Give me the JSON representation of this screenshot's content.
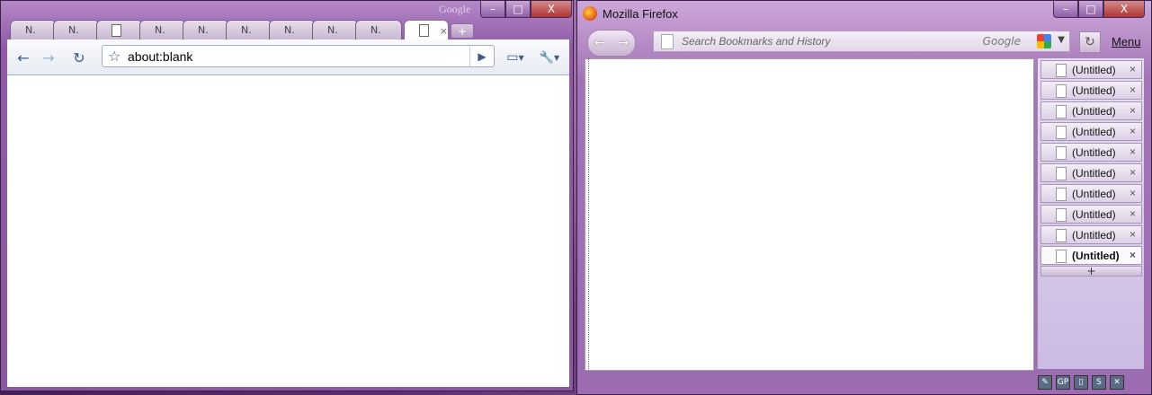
{
  "chrome": {
    "brand": "Google",
    "controls": {
      "minimize": "–",
      "maximize": "□",
      "close": "X"
    },
    "tabs": [
      {
        "label": "N."
      },
      {
        "label": "N."
      },
      {
        "label": ""
      },
      {
        "label": "N."
      },
      {
        "label": "N."
      },
      {
        "label": "N."
      },
      {
        "label": "N."
      },
      {
        "label": "N."
      },
      {
        "label": "N."
      },
      {
        "label": "",
        "active": true
      }
    ],
    "new_tab_label": "+",
    "toolbar": {
      "back_icon": "←",
      "forward_icon": "→",
      "reload_icon": "↻",
      "star_icon": "☆",
      "go_icon": "▶",
      "page_icon": "▭",
      "wrench_icon": "🔧",
      "url": "about:blank"
    }
  },
  "firefox": {
    "title": "Mozilla Firefox",
    "controls": {
      "minimize": "–",
      "maximize": "□",
      "close": "X"
    },
    "nav": {
      "back": "←",
      "forward": "→"
    },
    "search_placeholder": "Search Bookmarks and History",
    "engine": "Google",
    "reload_icon": "↻",
    "menu_label": "Menu",
    "side_tabs": [
      {
        "label": "(Untitled)"
      },
      {
        "label": "(Untitled)"
      },
      {
        "label": "(Untitled)"
      },
      {
        "label": "(Untitled)"
      },
      {
        "label": "(Untitled)"
      },
      {
        "label": "(Untitled)"
      },
      {
        "label": "(Untitled)"
      },
      {
        "label": "(Untitled)"
      },
      {
        "label": "(Untitled)"
      },
      {
        "label": "(Untitled)",
        "active": true
      }
    ],
    "side_tab_close": "×",
    "side_tab_add": "+",
    "status_icons": [
      "✎",
      "GP",
      "▯",
      "S",
      "✕"
    ]
  }
}
